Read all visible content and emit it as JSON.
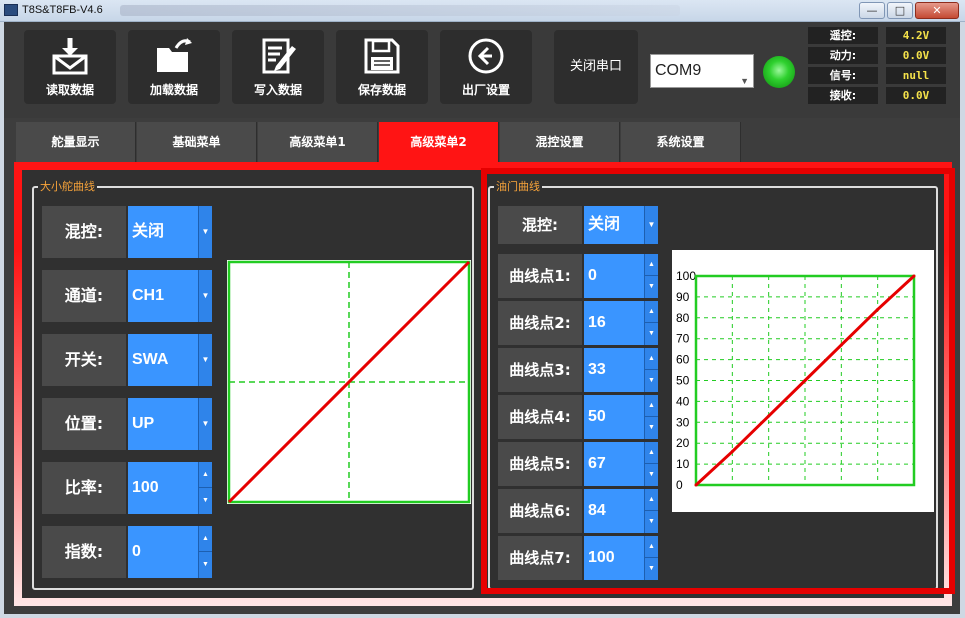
{
  "window": {
    "title": "T8S&T8FB-V4.6",
    "min": "—",
    "max": "□",
    "close": "✕"
  },
  "toolbar": {
    "buttons": [
      {
        "label": "读取数据",
        "icon": "download-envelope-icon"
      },
      {
        "label": "加载数据",
        "icon": "open-folder-icon"
      },
      {
        "label": "写入数据",
        "icon": "edit-document-icon"
      },
      {
        "label": "保存数据",
        "icon": "save-icon"
      },
      {
        "label": "出厂设置",
        "icon": "reset-icon"
      }
    ],
    "serial_button": "关闭串口",
    "com_port": "COM9",
    "led_color": "#2fd12f"
  },
  "status": [
    {
      "label": "遥控:",
      "value": "4.2V"
    },
    {
      "label": "动力:",
      "value": "0.0V"
    },
    {
      "label": "信号:",
      "value": "null"
    },
    {
      "label": "接收:",
      "value": "0.0V"
    }
  ],
  "tabs": [
    "舵量显示",
    "基础菜单",
    "高级菜单1",
    "高级菜单2",
    "混控设置",
    "系统设置"
  ],
  "active_tab": "高级菜单2",
  "left_group": {
    "title": "大小舵曲线",
    "rows": [
      {
        "label": "混控:",
        "value": "关闭",
        "control": "dropdown"
      },
      {
        "label": "通道:",
        "value": "CH1",
        "control": "dropdown"
      },
      {
        "label": "开关:",
        "value": "SWA",
        "control": "dropdown"
      },
      {
        "label": "位置:",
        "value": "UP",
        "control": "dropdown"
      },
      {
        "label": "比率:",
        "value": "100",
        "control": "spinner"
      },
      {
        "label": "指数:",
        "value": "0",
        "control": "spinner"
      }
    ]
  },
  "right_group": {
    "title": "油门曲线",
    "mix": {
      "label": "混控:",
      "value": "关闭"
    },
    "points": [
      {
        "label": "曲线点1:",
        "value": "0"
      },
      {
        "label": "曲线点2:",
        "value": "16"
      },
      {
        "label": "曲线点3:",
        "value": "33"
      },
      {
        "label": "曲线点4:",
        "value": "50"
      },
      {
        "label": "曲线点5:",
        "value": "67"
      },
      {
        "label": "曲线点6:",
        "value": "84"
      },
      {
        "label": "曲线点7:",
        "value": "100"
      }
    ]
  },
  "chart_data": [
    {
      "type": "line",
      "x": [
        -100,
        100
      ],
      "series": [
        {
          "values": [
            -100,
            100
          ]
        }
      ],
      "grid": "center-cross-dashed",
      "colors": {
        "frame": "#22cc22",
        "line": "#e60000"
      }
    },
    {
      "type": "line",
      "x": [
        0,
        1,
        2,
        3,
        4,
        5,
        6
      ],
      "series": [
        {
          "values": [
            0,
            16,
            33,
            50,
            67,
            84,
            100
          ]
        }
      ],
      "ylim": [
        0,
        100
      ],
      "yticks": [
        "100",
        "90",
        "80",
        "70",
        "60",
        "50",
        "40",
        "30",
        "20",
        "10",
        "0"
      ],
      "grid": true,
      "colors": {
        "frame": "#22cc22",
        "line": "#e60000"
      }
    }
  ]
}
